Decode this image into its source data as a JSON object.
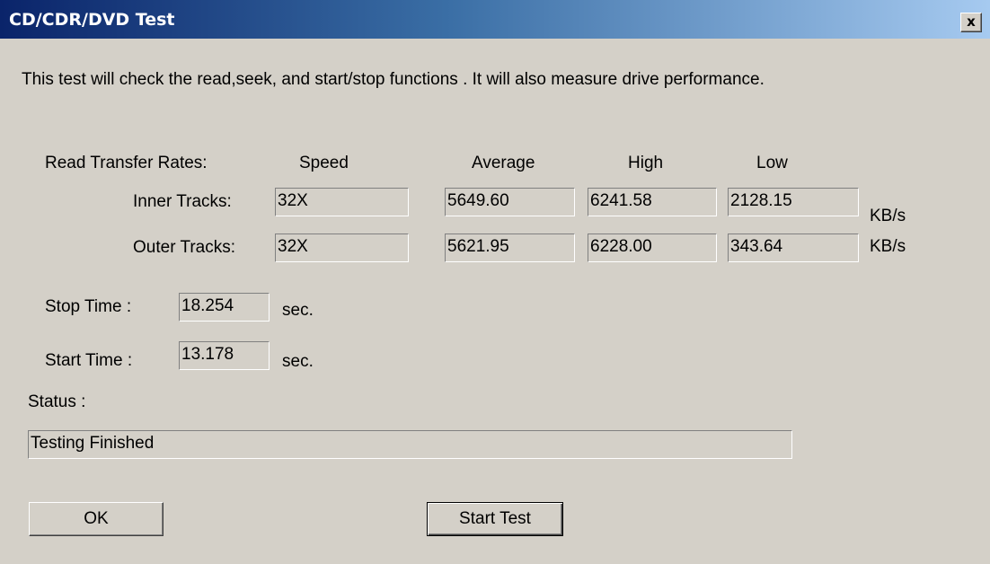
{
  "window": {
    "title": "CD/CDR/DVD Test",
    "close_label": "x"
  },
  "description": "This test will check the read,seek, and start/stop functions . It will also measure drive performance.",
  "rates": {
    "section_label": "Read Transfer Rates:",
    "columns": {
      "speed": "Speed",
      "average": "Average",
      "high": "High",
      "low": "Low"
    },
    "rows": [
      {
        "label": "Inner Tracks:",
        "speed": "32X",
        "average": "5649.60",
        "high": "6241.58",
        "low": "2128.15",
        "unit": "KB/s"
      },
      {
        "label": "Outer Tracks:",
        "speed": "32X",
        "average": "5621.95",
        "high": "6228.00",
        "low": "343.64",
        "unit": "KB/s"
      }
    ]
  },
  "stop_time": {
    "label": "Stop Time :",
    "value": "18.254",
    "unit": "sec."
  },
  "start_time": {
    "label": "Start Time :",
    "value": "13.178",
    "unit": "sec."
  },
  "status": {
    "label": "Status :",
    "value": "Testing Finished"
  },
  "buttons": {
    "ok": "OK",
    "start_test": "Start Test"
  },
  "colors": {
    "dialog_face": "#d4d0c8",
    "title_gradient_start": "#0a246a",
    "title_gradient_end": "#a6caf0",
    "title_text": "#ffffff"
  }
}
